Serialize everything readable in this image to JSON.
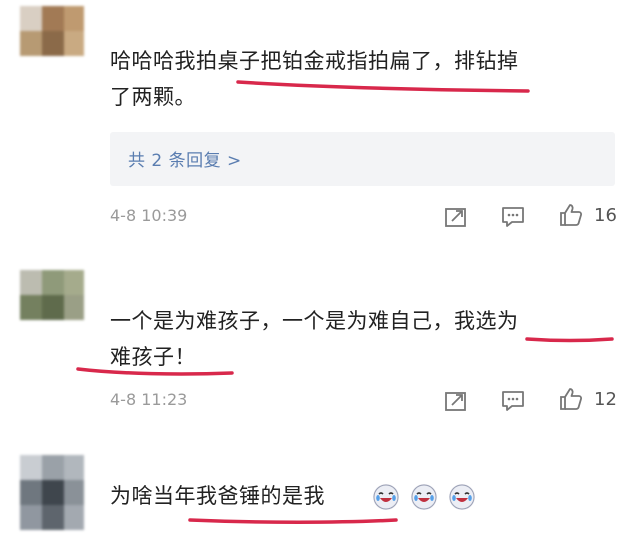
{
  "comments": [
    {
      "text_line1": "哈哈哈我拍桌子把铂金戒指拍扁了，排钻掉",
      "text_line2": "了两颗。",
      "reply_link": "共 2 条回复 >",
      "time": "4-8 10:39",
      "likes": "16",
      "icons": [
        "share-icon",
        "comment-icon",
        "like-icon"
      ]
    },
    {
      "text_line1": "一个是为难孩子，一个是为难自己，我选为",
      "text_line2": "难孩子！",
      "time": "4-8 11:23",
      "likes": "12",
      "icons": [
        "share-icon",
        "comment-icon",
        "like-icon"
      ]
    },
    {
      "text_line1": "为啥当年我爸锤的是我",
      "icons": [
        "laughing-cry-emoji"
      ]
    }
  ],
  "colors": {
    "underline": "#d8284b",
    "link": "#5a7db0",
    "timestamp": "#9a9a9a",
    "reply_bg": "#f3f4f6"
  }
}
